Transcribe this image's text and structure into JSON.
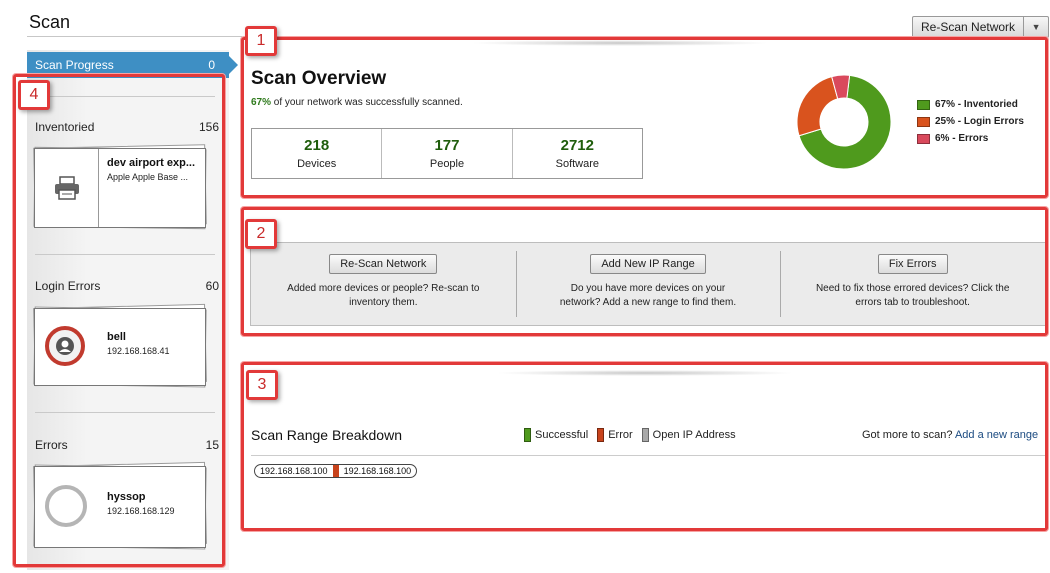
{
  "header": {
    "title": "Scan",
    "rescan_button": "Re-Scan Network"
  },
  "sidebar": {
    "active_item": {
      "label": "Scan Progress",
      "count": "0"
    },
    "sections": [
      {
        "label": "Inventoried",
        "count": "156",
        "card": {
          "title": "dev airport exp...",
          "subtitle": "Apple Apple Base ...",
          "icon": "printer-icon"
        }
      },
      {
        "label": "Login Errors",
        "count": "60",
        "card": {
          "title": "bell",
          "subtitle": "192.168.168.41",
          "icon": "user-avatar-icon"
        }
      },
      {
        "label": "Errors",
        "count": "15",
        "card": {
          "title": "hyssop",
          "subtitle": "192.168.168.129",
          "icon": "empty-circle-icon"
        }
      }
    ]
  },
  "callouts": [
    "1",
    "2",
    "3",
    "4"
  ],
  "overview": {
    "title": "Scan Overview",
    "percent": "67%",
    "subtitle_rest": " of your network was successfully scanned.",
    "stats": [
      {
        "value": "218",
        "label": "Devices"
      },
      {
        "value": "177",
        "label": "People"
      },
      {
        "value": "2712",
        "label": "Software"
      }
    ]
  },
  "chart_data": {
    "type": "pie",
    "categories": [
      "Inventoried",
      "Login Errors",
      "Errors"
    ],
    "values": [
      67,
      25,
      6
    ],
    "labels": [
      "67% - Inventoried",
      "25% - Login Errors",
      "6% - Errors"
    ],
    "colors": [
      "#4f9a1d",
      "#d9531e",
      "#d9495c"
    ],
    "legend": "right"
  },
  "actions": [
    {
      "button": "Re-Scan Network",
      "description": "Added more devices or people? Re-scan to inventory them."
    },
    {
      "button": "Add New IP Range",
      "description": "Do you have more devices on your network? Add a new range to find them."
    },
    {
      "button": "Fix Errors",
      "description": "Need to fix those errored devices? Click the errors tab to troubleshoot."
    }
  ],
  "breakdown": {
    "title": "Scan Range Breakdown",
    "legend": [
      {
        "label": "Successful",
        "color": "#4f9a1d"
      },
      {
        "label": "Error",
        "color": "#c8431c"
      },
      {
        "label": "Open IP Address",
        "color": "#a8a8a8"
      }
    ],
    "more_text": "Got more to scan? ",
    "more_link": "Add a new range",
    "range": {
      "start": "192.168.168.100",
      "end": "192.168.168.100"
    }
  }
}
